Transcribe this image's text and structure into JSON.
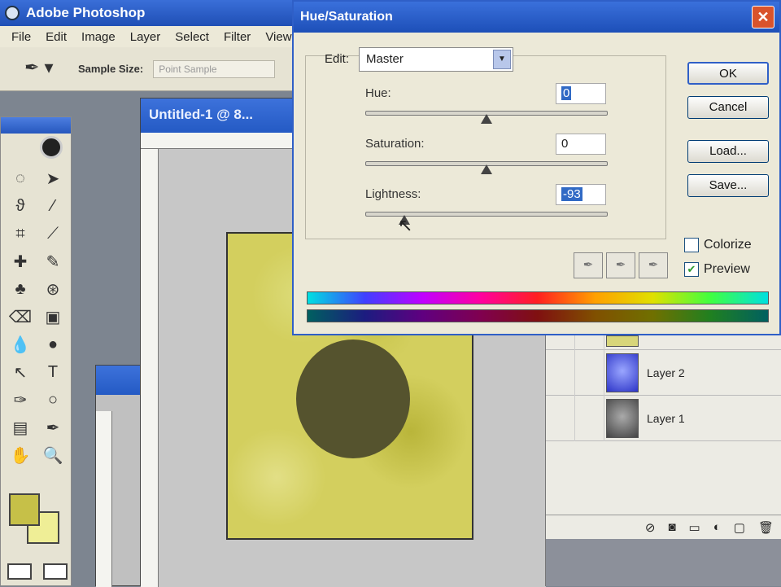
{
  "app": {
    "title": "Adobe Photoshop"
  },
  "menu": [
    "File",
    "Edit",
    "Image",
    "Layer",
    "Select",
    "Filter",
    "View"
  ],
  "options_bar": {
    "sample_size_label": "Sample Size:",
    "sample_size_value": "Point Sample"
  },
  "document": {
    "title": "Untitled-1 @ 8..."
  },
  "colors": {
    "foreground": "#c6c048",
    "background": "#efee96",
    "accent": "#2f5fc7"
  },
  "dialog": {
    "title": "Hue/Saturation",
    "close_label": "✕",
    "edit_label": "Edit:",
    "edit_value": "Master",
    "hue": {
      "label": "Hue:",
      "value": "0",
      "level": 0.5
    },
    "saturation": {
      "label": "Saturation:",
      "value": "0",
      "level": 0.5
    },
    "lightness": {
      "label": "Lightness:",
      "value": "-93",
      "level": 0.16
    },
    "buttons": {
      "ok": "OK",
      "cancel": "Cancel",
      "load": "Load...",
      "save": "Save..."
    },
    "colorize": {
      "label": "Colorize",
      "checked": false
    },
    "preview": {
      "label": "Preview",
      "checked": true
    }
  },
  "layers": [
    {
      "name": "Layer 2",
      "thumb": "blue"
    },
    {
      "name": "Layer 1",
      "thumb": "gray"
    }
  ]
}
